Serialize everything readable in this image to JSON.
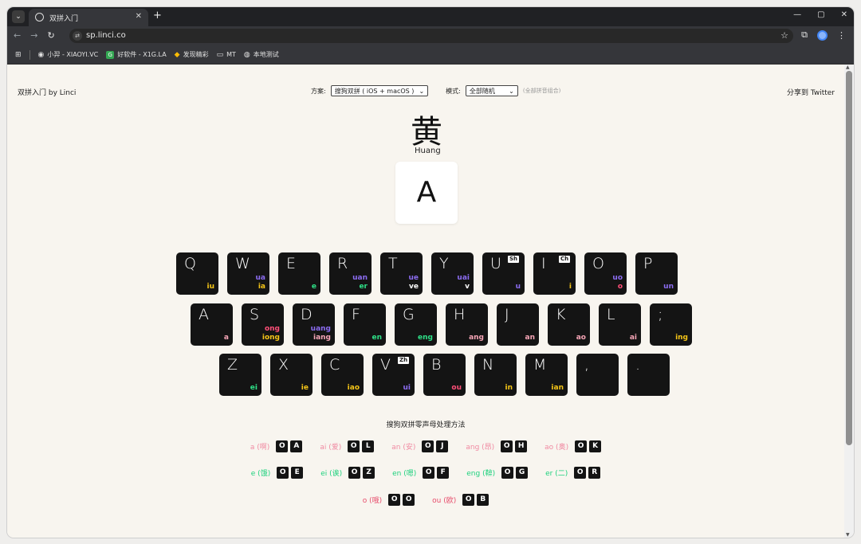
{
  "browser": {
    "tab_title": "双拼入门",
    "url": "sp.linci.co",
    "bookmarks": [
      {
        "label": "小羿 - XIAOYI.VC",
        "icon": "avatar-icon"
      },
      {
        "label": "好软件 - X1G.LA",
        "icon": "app-icon"
      },
      {
        "label": "发现精彩",
        "icon": "spark-icon"
      },
      {
        "label": "MT",
        "icon": "folder-icon"
      },
      {
        "label": "本地测试",
        "icon": "globe-icon"
      }
    ]
  },
  "header": {
    "brand": "双拼入门 by Linci",
    "share": "分享到 Twitter",
    "scheme_label": "方案:",
    "scheme_value": "搜狗双拼 ( iOS + macOS )",
    "mode_label": "模式:",
    "mode_value": "全部随机",
    "mode_hint": "(全部拼音组合)"
  },
  "quiz": {
    "hanzi": "黄",
    "pinyin": "Huang",
    "answer_key": "A"
  },
  "keyboard": {
    "row1": [
      {
        "letter": "Q",
        "v1": "",
        "v1_color": "",
        "v2": "iu",
        "v2_color": "c-yellow",
        "shengmu": ""
      },
      {
        "letter": "W",
        "v1": "ua",
        "v1_color": "c-purple",
        "v2": "ia",
        "v2_color": "c-yellow",
        "shengmu": ""
      },
      {
        "letter": "E",
        "v1": "",
        "v1_color": "",
        "v2": "e",
        "v2_color": "c-green",
        "shengmu": ""
      },
      {
        "letter": "R",
        "v1": "uan",
        "v1_color": "c-purple",
        "v2": "er",
        "v2_color": "c-green",
        "shengmu": ""
      },
      {
        "letter": "T",
        "v1": "ue",
        "v1_color": "c-purple",
        "v2": "ve",
        "v2_color": "c-white",
        "shengmu": ""
      },
      {
        "letter": "Y",
        "v1": "uai",
        "v1_color": "c-purple",
        "v2": "v",
        "v2_color": "c-white",
        "shengmu": ""
      },
      {
        "letter": "U",
        "v1": "",
        "v1_color": "",
        "v2": "u",
        "v2_color": "c-purple",
        "shengmu": "Sh"
      },
      {
        "letter": "I",
        "v1": "",
        "v1_color": "",
        "v2": "i",
        "v2_color": "c-yellow",
        "shengmu": "Ch"
      },
      {
        "letter": "O",
        "v1": "uo",
        "v1_color": "c-purple",
        "v2": "o",
        "v2_color": "c-pink",
        "shengmu": ""
      },
      {
        "letter": "P",
        "v1": "",
        "v1_color": "",
        "v2": "un",
        "v2_color": "c-purple",
        "shengmu": ""
      }
    ],
    "row2": [
      {
        "letter": "A",
        "v1": "",
        "v1_color": "",
        "v2": "a",
        "v2_color": "c-lpink",
        "shengmu": ""
      },
      {
        "letter": "S",
        "v1": "ong",
        "v1_color": "c-pink",
        "v2": "iong",
        "v2_color": "c-yellow",
        "shengmu": ""
      },
      {
        "letter": "D",
        "v1": "uang",
        "v1_color": "c-purple",
        "v2": "iang",
        "v2_color": "c-lpink",
        "shengmu": ""
      },
      {
        "letter": "F",
        "v1": "",
        "v1_color": "",
        "v2": "en",
        "v2_color": "c-green",
        "shengmu": ""
      },
      {
        "letter": "G",
        "v1": "",
        "v1_color": "",
        "v2": "eng",
        "v2_color": "c-green",
        "shengmu": ""
      },
      {
        "letter": "H",
        "v1": "",
        "v1_color": "",
        "v2": "ang",
        "v2_color": "c-lpink",
        "shengmu": ""
      },
      {
        "letter": "J",
        "v1": "",
        "v1_color": "",
        "v2": "an",
        "v2_color": "c-lpink",
        "shengmu": ""
      },
      {
        "letter": "K",
        "v1": "",
        "v1_color": "",
        "v2": "ao",
        "v2_color": "c-lpink",
        "shengmu": ""
      },
      {
        "letter": "L",
        "v1": "",
        "v1_color": "",
        "v2": "ai",
        "v2_color": "c-lpink",
        "shengmu": ""
      },
      {
        "letter": ";",
        "v1": "",
        "v1_color": "",
        "v2": "ing",
        "v2_color": "c-yellow",
        "shengmu": ""
      }
    ],
    "row3": [
      {
        "letter": "Z",
        "v1": "",
        "v1_color": "",
        "v2": "ei",
        "v2_color": "c-green",
        "shengmu": ""
      },
      {
        "letter": "X",
        "v1": "",
        "v1_color": "",
        "v2": "ie",
        "v2_color": "c-yellow",
        "shengmu": ""
      },
      {
        "letter": "C",
        "v1": "",
        "v1_color": "",
        "v2": "iao",
        "v2_color": "c-yellow",
        "shengmu": ""
      },
      {
        "letter": "V",
        "v1": "",
        "v1_color": "",
        "v2": "ui",
        "v2_color": "c-purple",
        "shengmu": "Zh"
      },
      {
        "letter": "B",
        "v1": "",
        "v1_color": "",
        "v2": "ou",
        "v2_color": "c-pink",
        "shengmu": ""
      },
      {
        "letter": "N",
        "v1": "",
        "v1_color": "",
        "v2": "in",
        "v2_color": "c-yellow",
        "shengmu": ""
      },
      {
        "letter": "M",
        "v1": "",
        "v1_color": "",
        "v2": "ian",
        "v2_color": "c-yellow",
        "shengmu": ""
      },
      {
        "letter": ",",
        "v1": "",
        "v1_color": "",
        "v2": "",
        "v2_color": "",
        "shengmu": ""
      },
      {
        "letter": ".",
        "v1": "",
        "v1_color": "",
        "v2": "",
        "v2_color": "",
        "shengmu": ""
      }
    ]
  },
  "zero_initial": {
    "title": "搜狗双拼零声母处理方法",
    "rows": [
      [
        {
          "label": "a (啊)",
          "color": "t-pink",
          "keys": [
            "O",
            "A"
          ]
        },
        {
          "label": "ai (爱)",
          "color": "t-pink",
          "keys": [
            "O",
            "L"
          ]
        },
        {
          "label": "an (安)",
          "color": "t-pink",
          "keys": [
            "O",
            "J"
          ]
        },
        {
          "label": "ang (昂)",
          "color": "t-pink",
          "keys": [
            "O",
            "H"
          ]
        },
        {
          "label": "ao (奥)",
          "color": "t-pink",
          "keys": [
            "O",
            "K"
          ]
        }
      ],
      [
        {
          "label": "e (饿)",
          "color": "t-green",
          "keys": [
            "O",
            "E"
          ]
        },
        {
          "label": "ei (诶)",
          "color": "t-green",
          "keys": [
            "O",
            "Z"
          ]
        },
        {
          "label": "en (嗯)",
          "color": "t-green",
          "keys": [
            "O",
            "F"
          ]
        },
        {
          "label": "eng (鞥)",
          "color": "t-green",
          "keys": [
            "O",
            "G"
          ]
        },
        {
          "label": "er (二)",
          "color": "t-green",
          "keys": [
            "O",
            "R"
          ]
        }
      ],
      [
        {
          "label": "o (哦)",
          "color": "t-red",
          "keys": [
            "O",
            "O"
          ]
        },
        {
          "label": "ou (欧)",
          "color": "t-red",
          "keys": [
            "O",
            "B"
          ]
        }
      ]
    ]
  }
}
